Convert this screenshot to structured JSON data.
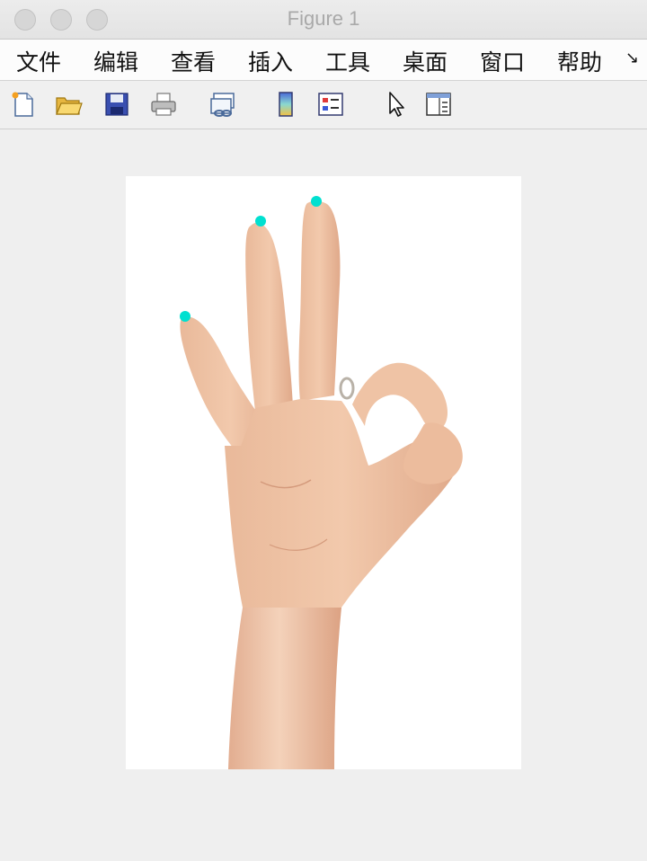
{
  "window": {
    "title": "Figure 1"
  },
  "menu": {
    "items": [
      {
        "label": "文件"
      },
      {
        "label": "编辑"
      },
      {
        "label": "查看"
      },
      {
        "label": "插入"
      },
      {
        "label": "工具"
      },
      {
        "label": "桌面"
      },
      {
        "label": "窗口"
      },
      {
        "label": "帮助"
      }
    ],
    "overflow_icon": "menu-overflow-arrow"
  },
  "toolbar": {
    "icons": [
      "new-figure-icon",
      "open-file-icon",
      "save-icon",
      "print-icon",
      "link-plot-icon",
      "colorbar-icon",
      "legend-icon",
      "pointer-icon",
      "property-editor-icon"
    ]
  },
  "figure": {
    "image_subject": "hand making OK gesture",
    "markers": {
      "color": "#00e0d0",
      "count": 3
    }
  }
}
